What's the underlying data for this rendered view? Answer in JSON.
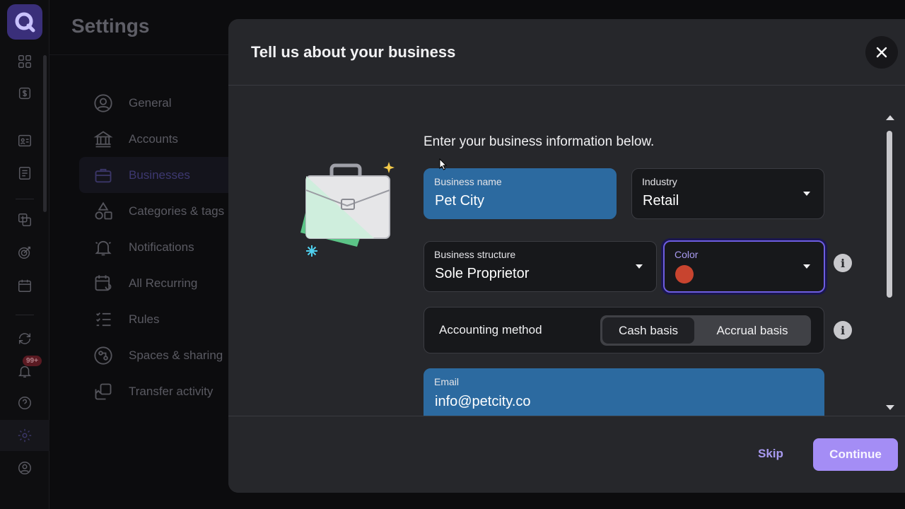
{
  "app": {
    "brand_color": "#3a2f7a"
  },
  "rail": {
    "icons": [
      "dashboard-icon",
      "transactions-icon",
      "wallet-icon",
      "reports-icon",
      "budget-icon",
      "goals-icon",
      "calendar-icon",
      "sync-icon",
      "bell-icon",
      "help-icon",
      "settings-icon",
      "profile-icon"
    ],
    "notification_badge": "99+"
  },
  "settings": {
    "title": "Settings",
    "nav": [
      {
        "label": "General",
        "icon": "user-circle-icon"
      },
      {
        "label": "Accounts",
        "icon": "bank-icon"
      },
      {
        "label": "Businesses",
        "icon": "briefcase-icon",
        "active": true
      },
      {
        "label": "Categories & tags",
        "icon": "shapes-icon"
      },
      {
        "label": "Notifications",
        "icon": "bell-icon"
      },
      {
        "label": "All Recurring",
        "icon": "recurring-calendar-icon"
      },
      {
        "label": "Rules",
        "icon": "list-icon"
      },
      {
        "label": "Spaces & sharing",
        "icon": "share-icon"
      },
      {
        "label": "Transfer activity",
        "icon": "transfer-icon"
      }
    ]
  },
  "modal": {
    "title": "Tell us about your business",
    "intro": "Enter your business information below.",
    "fields": {
      "business_name": {
        "label": "Business name",
        "value": "Pet City"
      },
      "industry": {
        "label": "Industry",
        "value": "Retail"
      },
      "business_structure": {
        "label": "Business structure",
        "value": "Sole Proprietor"
      },
      "color": {
        "label": "Color",
        "value_color": "#c8442f"
      },
      "accounting_method": {
        "label": "Accounting method",
        "options": [
          "Cash basis",
          "Accrual basis"
        ],
        "selected": "Cash basis"
      },
      "email": {
        "label": "Email",
        "value": "info@petcity.co"
      }
    },
    "info_glyph": "i",
    "footer": {
      "skip_label": "Skip",
      "continue_label": "Continue"
    },
    "accent_color": "#a48df5"
  }
}
